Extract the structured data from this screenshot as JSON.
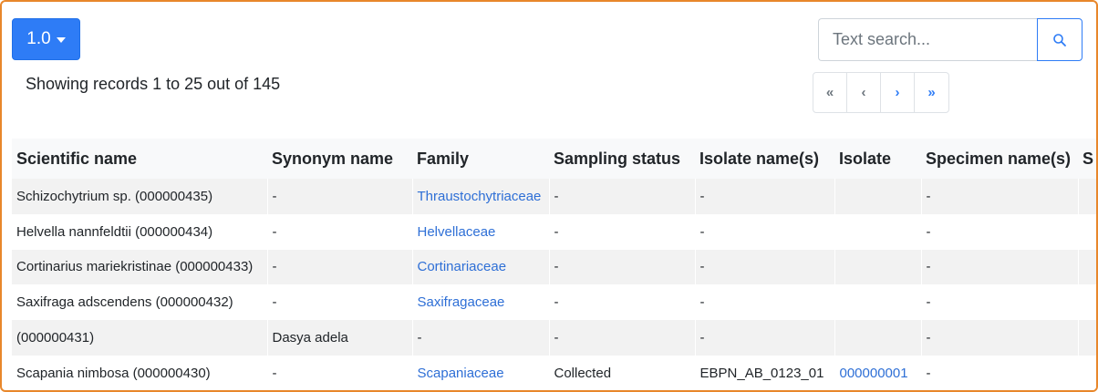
{
  "version_button": {
    "label": "1.0"
  },
  "records_text": "Showing records 1 to 25 out of 145",
  "search": {
    "placeholder": "Text search..."
  },
  "pagination": {
    "first": "«",
    "prev": "‹",
    "next": "›",
    "last": "»"
  },
  "table": {
    "columns": [
      "Scientific name",
      "Synonym name",
      "Family",
      "Sampling status",
      "Isolate name(s)",
      "Isolate",
      "Specimen name(s)",
      "S"
    ],
    "rows": [
      [
        "Schizochytrium sp. (000000435)",
        "-",
        "Thraustochytriaceae",
        "-",
        "-",
        "",
        "-",
        ""
      ],
      [
        "Helvella nannfeldtii (000000434)",
        "-",
        "Helvellaceae",
        "-",
        "-",
        "",
        "-",
        ""
      ],
      [
        "Cortinarius mariekristinae (000000433)",
        "-",
        "Cortinariaceae",
        "-",
        "-",
        "",
        "-",
        ""
      ],
      [
        "Saxifraga adscendens (000000432)",
        "-",
        "Saxifragaceae",
        "-",
        "-",
        "",
        "-",
        ""
      ],
      [
        "(000000431)",
        "Dasya adela",
        "-",
        "-",
        "-",
        "",
        "-",
        ""
      ],
      [
        "Scapania nimbosa (000000430)",
        "-",
        "Scapaniaceae",
        "Collected",
        "EBPN_AB_0123_01",
        "000000001",
        "-",
        ""
      ]
    ]
  },
  "colors": {
    "primary": "#2e7cf6",
    "link": "#2e6fd6",
    "frame": "#e8872b"
  },
  "icons": {
    "search": "search-icon",
    "caret": "caret-down-icon"
  }
}
